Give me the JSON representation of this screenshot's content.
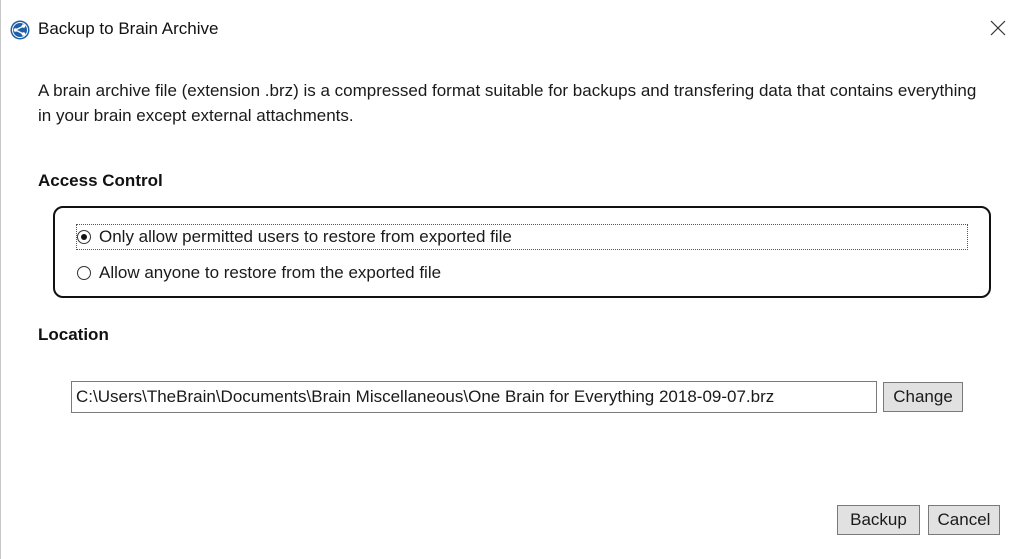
{
  "window": {
    "title": "Backup to Brain Archive",
    "icon": "thebrain-app-icon",
    "close_icon": "close-x-icon"
  },
  "description": "A brain archive file (extension .brz) is a compressed format suitable for backups and transfering data that contains everything in your brain except external attachments.",
  "access_control": {
    "heading": "Access Control",
    "options": [
      {
        "label": "Only allow permitted users to restore from exported file",
        "selected": true
      },
      {
        "label": "Allow anyone to restore from the exported file",
        "selected": false
      }
    ]
  },
  "location": {
    "heading": "Location",
    "path": "C:\\Users\\TheBrain\\Documents\\Brain Miscellaneous\\One Brain for Everything 2018-09-07.brz",
    "change_label": "Change"
  },
  "buttons": {
    "backup_label": "Backup",
    "cancel_label": "Cancel"
  },
  "colors": {
    "app_icon": "#1f5fa8",
    "button_bg": "#e1e1e1",
    "border": "#7a7a7a"
  }
}
